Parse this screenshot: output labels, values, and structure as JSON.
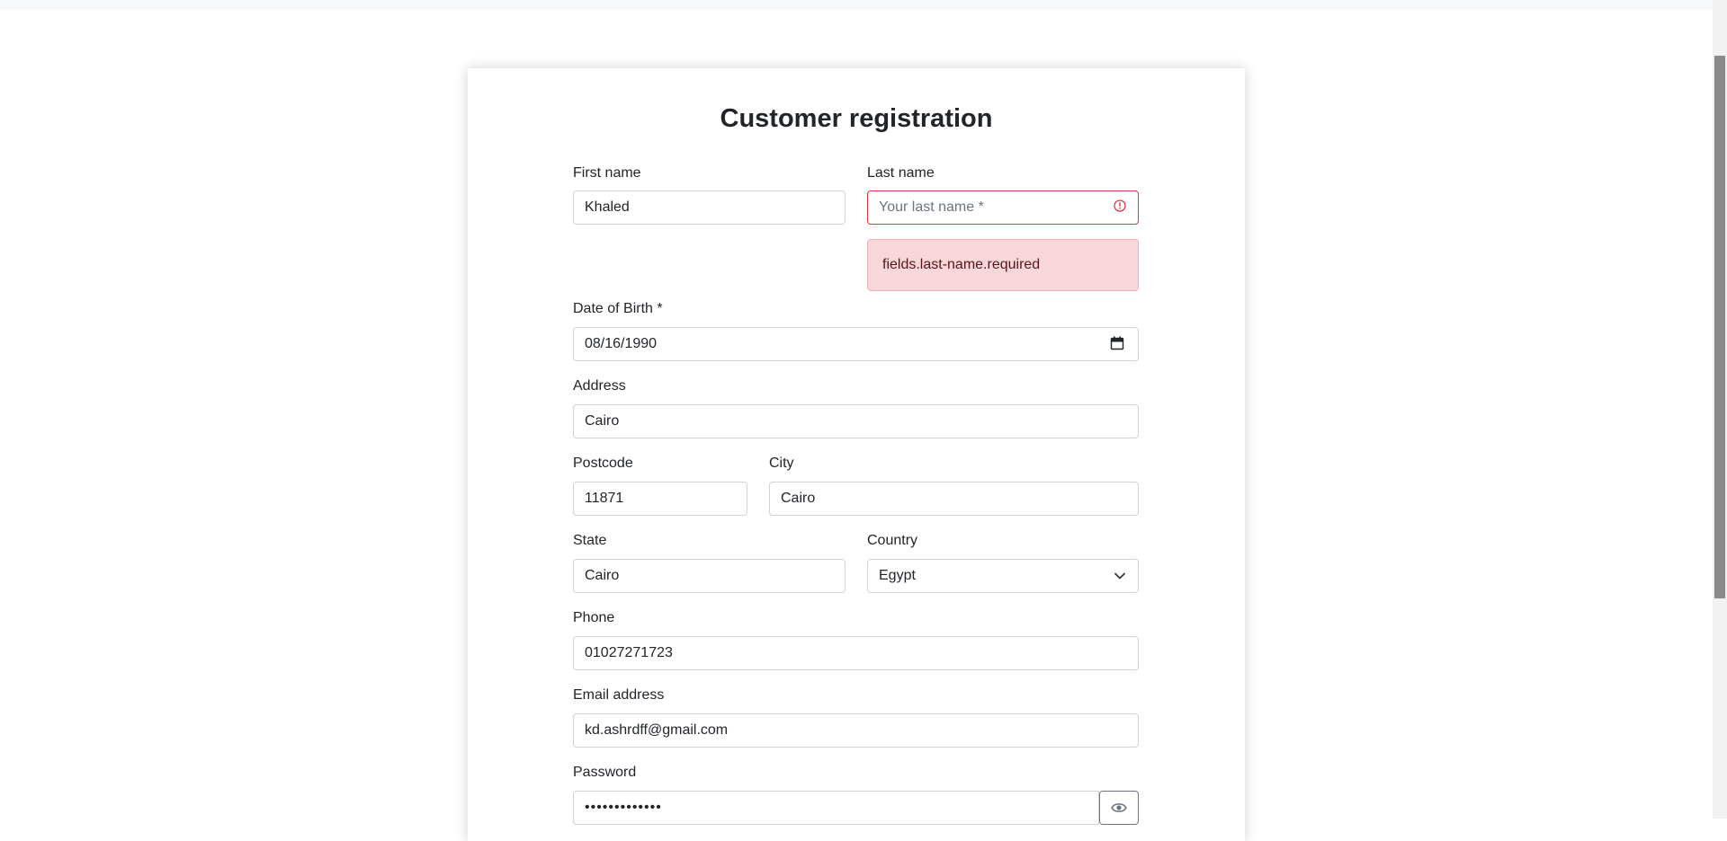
{
  "page": {
    "title": "Customer registration"
  },
  "fields": {
    "first_name": {
      "label": "First name",
      "value": "Khaled"
    },
    "last_name": {
      "label": "Last name",
      "value": "",
      "placeholder": "Your last name *",
      "error": "fields.last-name.required"
    },
    "dob": {
      "label": "Date of Birth *",
      "value": "08/16/1990"
    },
    "address": {
      "label": "Address",
      "value": "Cairo"
    },
    "postcode": {
      "label": "Postcode",
      "value": "11871"
    },
    "city": {
      "label": "City",
      "value": "Cairo"
    },
    "state": {
      "label": "State",
      "value": "Cairo"
    },
    "country": {
      "label": "Country",
      "value": "Egypt"
    },
    "phone": {
      "label": "Phone",
      "value": "01027271723"
    },
    "email": {
      "label": "Email address",
      "value": "kd.ashrdff@gmail.com"
    },
    "password": {
      "label": "Password",
      "value": "•••••••••••••"
    }
  },
  "icons": {
    "invalid": "exclamation-circle-icon",
    "calendar": "calendar-icon",
    "dropdown": "chevron-down-icon",
    "visibility": "eye-icon"
  },
  "colors": {
    "error": "#dc3545",
    "error_bg": "#f8d7da",
    "error_text": "#58151c",
    "border": "#ced4da"
  }
}
